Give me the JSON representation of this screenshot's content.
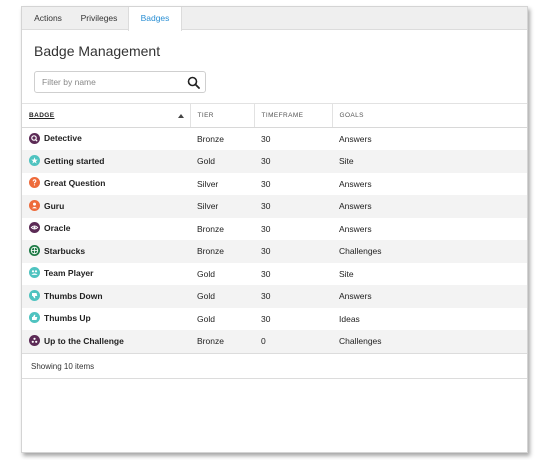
{
  "tabs": [
    {
      "label": "Actions"
    },
    {
      "label": "Privileges"
    },
    {
      "label": "Badges"
    }
  ],
  "page_title": "Badge Management",
  "filter": {
    "placeholder": "Filter by name",
    "value": ""
  },
  "table": {
    "columns": [
      "BADGE",
      "TIER",
      "TIMEFRAME",
      "GOALS"
    ],
    "rows": [
      {
        "badge": "Detective",
        "tier": "Bronze",
        "timeframe": "30",
        "goals": "Answers",
        "icon": "magnifier-icon",
        "color": "#5b2a55"
      },
      {
        "badge": "Getting started",
        "tier": "Gold",
        "timeframe": "30",
        "goals": "Site",
        "icon": "star-icon",
        "color": "#4fc3c0"
      },
      {
        "badge": "Great Question",
        "tier": "Silver",
        "timeframe": "30",
        "goals": "Answers",
        "icon": "question-icon",
        "color": "#ee6b3b"
      },
      {
        "badge": "Guru",
        "tier": "Silver",
        "timeframe": "30",
        "goals": "Answers",
        "icon": "person-icon",
        "color": "#ee6b3b"
      },
      {
        "badge": "Oracle",
        "tier": "Bronze",
        "timeframe": "30",
        "goals": "Answers",
        "icon": "eye-icon",
        "color": "#5b2a55"
      },
      {
        "badge": "Starbucks",
        "tier": "Bronze",
        "timeframe": "30",
        "goals": "Challenges",
        "icon": "starbucks-icon",
        "color": "#1e7a45"
      },
      {
        "badge": "Team Player",
        "tier": "Gold",
        "timeframe": "30",
        "goals": "Site",
        "icon": "team-icon",
        "color": "#4fc3c0"
      },
      {
        "badge": "Thumbs Down",
        "tier": "Gold",
        "timeframe": "30",
        "goals": "Answers",
        "icon": "thumbs-down-icon",
        "color": "#4fc3c0"
      },
      {
        "badge": "Thumbs Up",
        "tier": "Gold",
        "timeframe": "30",
        "goals": "Ideas",
        "icon": "thumbs-up-icon",
        "color": "#4fc3c0"
      },
      {
        "badge": "Up to the Challenge",
        "tier": "Bronze",
        "timeframe": "0",
        "goals": "Challenges",
        "icon": "trophy-icon",
        "color": "#5b2a55"
      }
    ]
  },
  "footer": {
    "text": "Showing 10 items"
  },
  "colors": {
    "accent": "#2a8fd4",
    "row_stripe": "#f3f3f3"
  }
}
